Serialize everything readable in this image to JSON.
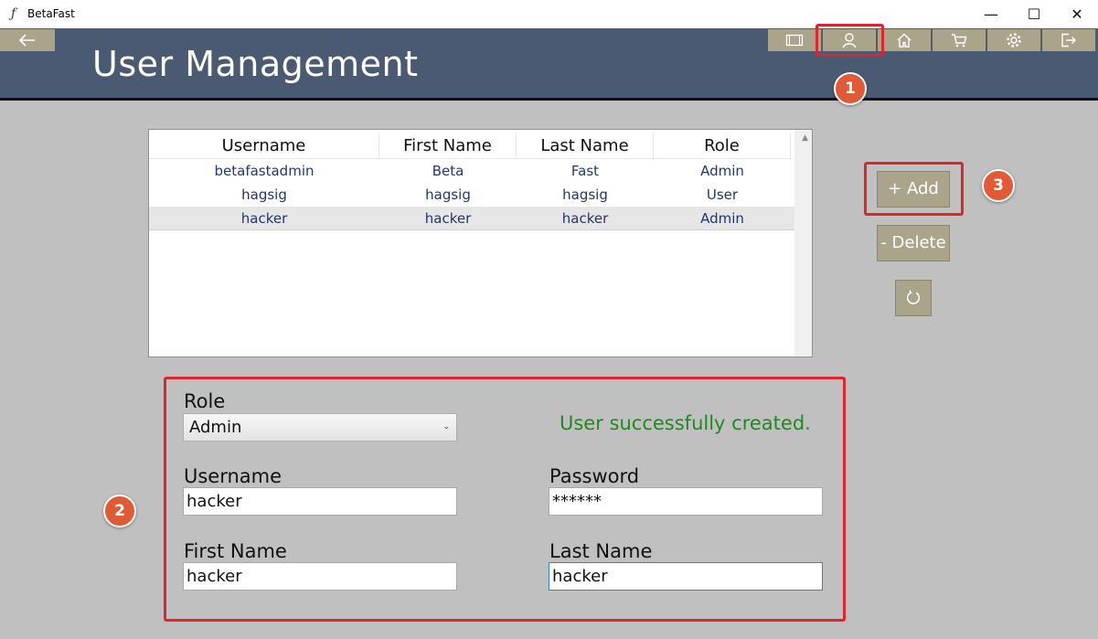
{
  "window": {
    "title": "BetaFast",
    "icon_glyph": "ƒ",
    "minimize_glyph": "—",
    "maximize_glyph": "☐",
    "close_glyph": "✕"
  },
  "header": {
    "page_title": "User Management",
    "back_icon": "arrow-left-icon",
    "nav": [
      "film-icon",
      "user-icon",
      "home-icon",
      "cart-icon",
      "gear-icon",
      "logout-icon"
    ]
  },
  "table": {
    "columns": [
      "Username",
      "First Name",
      "Last Name",
      "Role"
    ],
    "rows": [
      [
        "betafastadmin",
        "Beta",
        "Fast",
        "Admin"
      ],
      [
        "hagsig",
        "hagsig",
        "hagsig",
        "User"
      ],
      [
        "hacker",
        "hacker",
        "hacker",
        "Admin"
      ]
    ],
    "selected_row_index": 2
  },
  "buttons": {
    "add_label": "+ Add",
    "delete_label": "- Delete",
    "refresh_icon": "refresh-icon"
  },
  "form": {
    "role_label": "Role",
    "role_value": "Admin",
    "username_label": "Username",
    "username_value": "hacker",
    "password_label": "Password",
    "password_value": "******",
    "first_name_label": "First Name",
    "first_name_value": "hacker",
    "last_name_label": "Last Name",
    "last_name_value": "hacker",
    "status_message": "User successfully created."
  },
  "annotations": {
    "badges": [
      "1",
      "2",
      "3"
    ],
    "highlight_color": "#e0242c",
    "badge_color": "#e05a36"
  },
  "colors": {
    "header_bg": "#4b5a73",
    "button_bg": "#a9a48a",
    "page_bg": "#c0c0c0",
    "row_text": "#233574",
    "status_text": "#1f8a1f"
  }
}
